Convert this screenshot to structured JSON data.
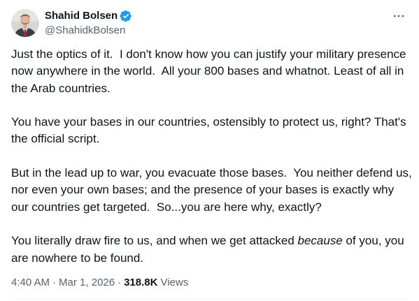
{
  "author": {
    "display_name": "Shahid Bolsen",
    "handle": "@ShahidkBolsen",
    "verified": true,
    "verified_color": "#1d9bf0"
  },
  "tweet": {
    "paragraphs": [
      "Just the optics of it.  I don't know how you can justify your military presence now anywhere in the world.  All your 800 bases and whatnot. Least of all in the Arab countries.",
      "You have your bases in our countries, ostensibly to protect us, right? That's the official script.",
      "But in the lead up to war, you evacuate those bases.  You neither defend us, nor even your own bases; and the presence of your bases is exactly why our countries get targeted.  So...you are here why, exactly?"
    ],
    "last_paragraph": {
      "before": "You literally draw fire to us, and when we get attacked ",
      "emphasis": "because",
      "after": " of you, you are nowhere to be found."
    }
  },
  "meta": {
    "time": "4:40 AM",
    "separator": "·",
    "date": "Mar 1, 2026",
    "views_count": "318.8K",
    "views_label": "Views"
  },
  "icons": {
    "avatar": "avatar-photo",
    "verified": "verified-badge-icon",
    "more": "more-options-icon"
  },
  "colors": {
    "text": "#0f1419",
    "secondary": "#536471",
    "accent": "#1d9bf0"
  }
}
